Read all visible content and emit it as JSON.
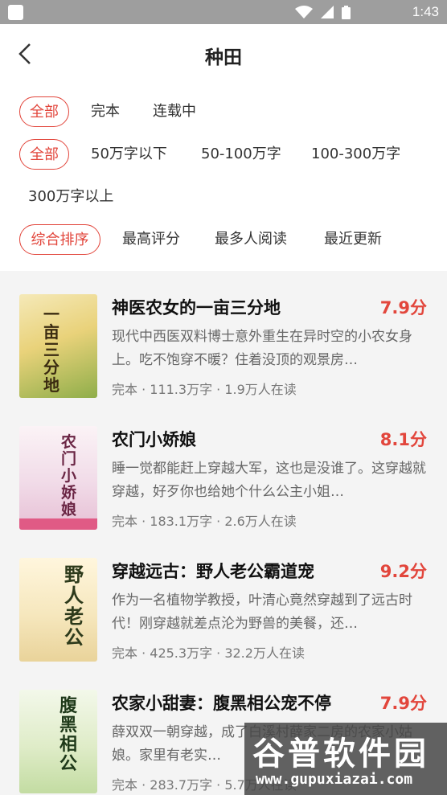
{
  "status_bar": {
    "time": "1:43"
  },
  "header": {
    "title": "种田",
    "back_icon": "chevron-left-icon"
  },
  "filters": {
    "status": [
      "全部",
      "完本",
      "连载中"
    ],
    "word_count": [
      "全部",
      "50万字以下",
      "50-100万字",
      "100-300万字",
      "300万字以上"
    ],
    "sort": [
      "综合排序",
      "最高评分",
      "最多人阅读",
      "最近更新"
    ]
  },
  "books": [
    {
      "title": "神医农女的一亩三分地",
      "score": "7.9分",
      "desc": "现代中西医双料博士意外重生在异时空的小农女身上。吃不饱穿不暖？住着没顶的观景房…",
      "meta": "完本 · 111.3万字 · 1.9万人在读",
      "cover_text": "一亩三分地"
    },
    {
      "title": "农门小娇娘",
      "score": "8.1分",
      "desc": "睡一觉都能赶上穿越大军，这也是没谁了。这穿越就穿越，好歹你也给她个什么公主小姐…",
      "meta": "完本 · 183.1万字 · 2.6万人在读",
      "cover_text": "农门小娇娘"
    },
    {
      "title": "穿越远古：野人老公霸道宠",
      "score": "9.2分",
      "desc": "作为一名植物学教授，叶清心竟然穿越到了远古时代！刚穿越就差点沦为野兽的美餐，还…",
      "meta": "完本 · 425.3万字 · 32.2万人在读",
      "cover_text": "野人老公"
    },
    {
      "title": "农家小甜妻：腹黑相公宠不停",
      "score": "7.9分",
      "desc": "薛双双一朝穿越，成了白溪村薛家二房的农家小姑娘。家里有老实…",
      "meta": "完本 · 283.7万字 · 5.7万人在读",
      "cover_text": "腹黑相公"
    }
  ],
  "watermark": {
    "title": "谷普软件园",
    "url": "www.gupuxiazai.com"
  },
  "colors": {
    "accent": "#e2463c"
  }
}
